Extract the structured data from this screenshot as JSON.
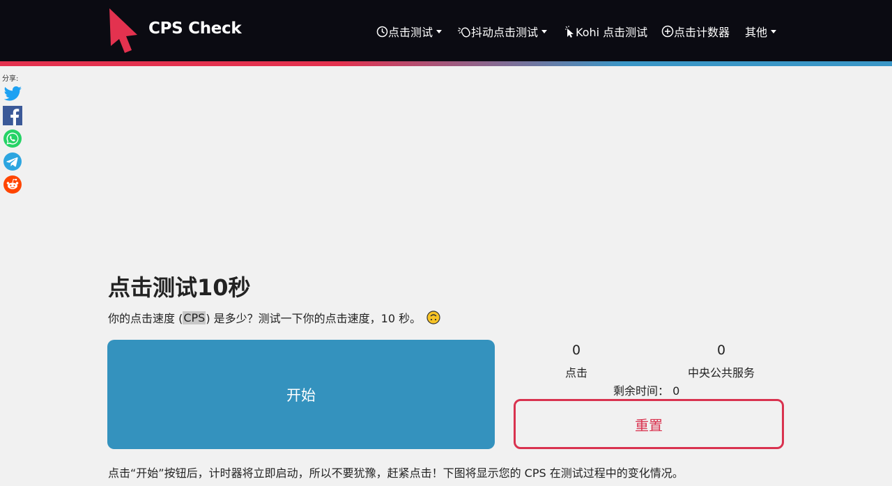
{
  "header": {
    "brand": "CPS Check",
    "nav": [
      {
        "label": "点击测试",
        "icon": "clock-icon",
        "dropdown": true
      },
      {
        "label": "抖动点击测试",
        "icon": "mouse-icon",
        "dropdown": true
      },
      {
        "label": "Kohi 点击测试",
        "icon": "cursor-icon",
        "dropdown": false
      },
      {
        "label": "点击计数器",
        "icon": "plus-circle-icon",
        "dropdown": false
      },
      {
        "label": "其他",
        "icon": "",
        "dropdown": true
      }
    ]
  },
  "share": {
    "label": "分享:",
    "buttons": [
      "twitter-icon",
      "facebook-icon",
      "whatsapp-icon",
      "telegram-icon",
      "reddit-icon"
    ]
  },
  "main": {
    "title": "点击测试10秒",
    "subtitle_before": "你的点击速度 (",
    "subtitle_highlight": "CPS",
    "subtitle_after": ") 是多少？测试一下你的点击速度，10 秒。",
    "start_label": "开始",
    "stats": {
      "clicks_value": "0",
      "clicks_label": "点击",
      "cps_value": "0",
      "cps_label": "中央公共服务",
      "remaining_label": "剩余时间：",
      "remaining_value": "0"
    },
    "reset_label": "重置",
    "footer_text": "点击“开始”按钮后，计时器将立即启动，所以不要犹豫，赶紧点击！下图将显示您的 CPS 在测试过程中的变化情况。"
  },
  "colors": {
    "navbar": "#0b0b12",
    "accent_red": "#e3324f",
    "accent_blue": "#3492be",
    "background": "#f1f1f1"
  }
}
